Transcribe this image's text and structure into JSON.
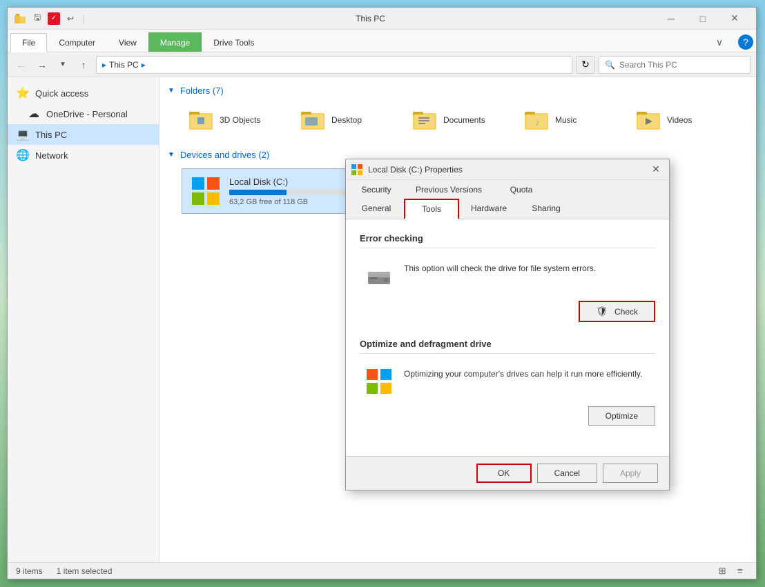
{
  "desktop": {
    "background": "meadow"
  },
  "explorer": {
    "title": "This PC",
    "window_controls": {
      "minimize": "─",
      "maximize": "□",
      "close": "✕"
    },
    "ribbon": {
      "tabs": [
        {
          "id": "file",
          "label": "File",
          "active": true
        },
        {
          "id": "computer",
          "label": "Computer",
          "active": false
        },
        {
          "id": "view",
          "label": "View",
          "active": false
        },
        {
          "id": "manage",
          "label": "Manage",
          "active": false,
          "special": "manage"
        },
        {
          "id": "drive-tools",
          "label": "Drive Tools",
          "active": false
        }
      ],
      "expand_icon": "∨",
      "help_icon": "?"
    },
    "address_bar": {
      "back_icon": "←",
      "forward_icon": "→",
      "dropdown_icon": "∨",
      "up_icon": "↑",
      "path": "This PC",
      "path_prefix": "▸",
      "refresh_icon": "↻",
      "search_placeholder": "Search This PC",
      "search_icon": "🔍"
    },
    "sidebar": {
      "items": [
        {
          "id": "quick-access",
          "label": "Quick access",
          "icon": "⭐",
          "active": false
        },
        {
          "id": "onedrive",
          "label": "OneDrive - Personal",
          "icon": "☁",
          "active": false
        },
        {
          "id": "this-pc",
          "label": "This PC",
          "icon": "💻",
          "active": true
        },
        {
          "id": "network",
          "label": "Network",
          "icon": "🌐",
          "active": false
        }
      ]
    },
    "content": {
      "folders_section": {
        "label": "Folders (7)",
        "items": [
          {
            "id": "3d-objects",
            "name": "3D Objects"
          },
          {
            "id": "desktop",
            "name": "Desktop"
          },
          {
            "id": "documents",
            "name": "Documents"
          },
          {
            "id": "music",
            "name": "Music"
          },
          {
            "id": "videos",
            "name": "Videos"
          }
        ]
      },
      "drives_section": {
        "label": "Devices and drives (2)",
        "items": [
          {
            "id": "local-disk-c",
            "name": "Local Disk (C:)",
            "size_free": "63,2 GB free of 118 GB",
            "bar_fill_pct": 46
          }
        ]
      }
    },
    "status_bar": {
      "items_count": "9 items",
      "selected": "1 item selected"
    }
  },
  "properties_dialog": {
    "title": "Local Disk (C:) Properties",
    "close_icon": "✕",
    "tabs": {
      "row1": [
        {
          "id": "security",
          "label": "Security"
        },
        {
          "id": "previous-versions",
          "label": "Previous Versions"
        },
        {
          "id": "quota",
          "label": "Quota"
        }
      ],
      "row2": [
        {
          "id": "general",
          "label": "General"
        },
        {
          "id": "tools",
          "label": "Tools",
          "active": true,
          "highlighted": true
        },
        {
          "id": "hardware",
          "label": "Hardware"
        },
        {
          "id": "sharing",
          "label": "Sharing"
        }
      ]
    },
    "sections": {
      "error_checking": {
        "title": "Error checking",
        "description": "This option will check the drive for file system errors.",
        "button": "Check",
        "button_highlighted": true
      },
      "optimize": {
        "title": "Optimize and defragment drive",
        "description": "Optimizing your computer's drives can help it run more efficiently.",
        "button": "Optimize"
      }
    },
    "footer": {
      "ok_label": "OK",
      "cancel_label": "Cancel",
      "apply_label": "Apply",
      "ok_highlighted": true,
      "apply_disabled": true
    }
  }
}
